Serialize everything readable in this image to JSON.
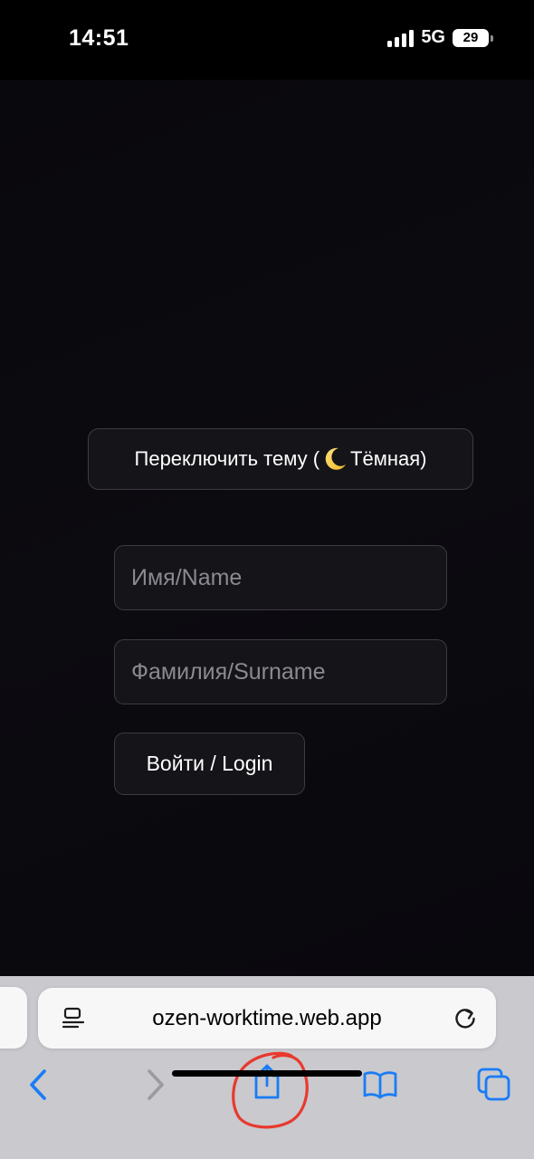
{
  "status_bar": {
    "time": "14:51",
    "network": "5G",
    "battery": "29"
  },
  "page": {
    "theme_button_prefix": "Переключить тему (",
    "theme_button_suffix": " Тёмная)",
    "theme_icon": "crescent-moon-icon",
    "name_placeholder": "Имя/Name",
    "surname_placeholder": "Фамилия/Surname",
    "login_label": "Войти / Login"
  },
  "safari": {
    "url": "ozen-worktime.web.app",
    "icons": [
      "reader-icon",
      "reload-icon",
      "back-icon",
      "forward-icon",
      "share-icon",
      "bookmarks-icon",
      "tabs-icon"
    ],
    "accent_color": "#1a7cf5",
    "annotation_color": "#e8392e"
  }
}
